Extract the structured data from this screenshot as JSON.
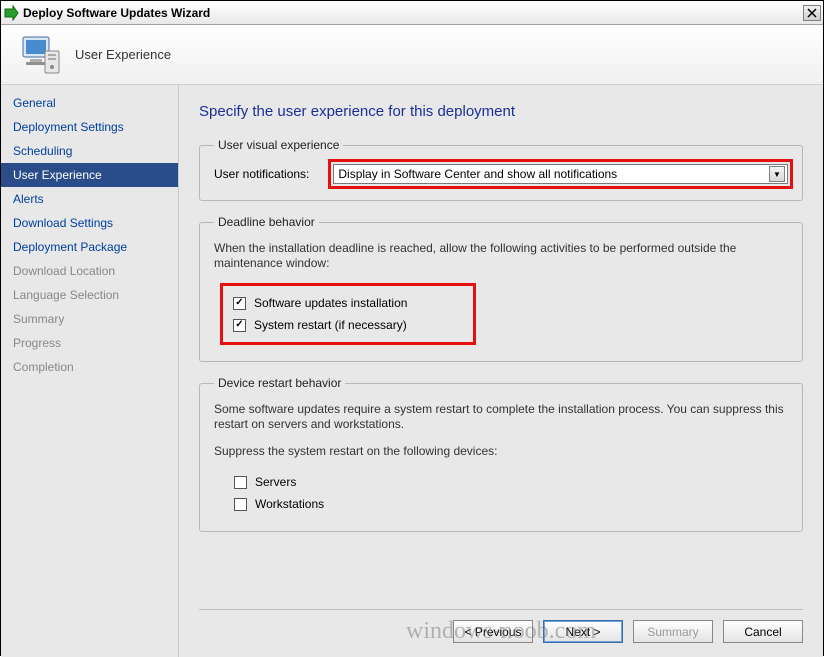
{
  "titlebar": {
    "title": "Deploy Software Updates Wizard"
  },
  "banner": {
    "text": "User Experience"
  },
  "sidebar": {
    "items": [
      {
        "label": "General",
        "state": "enabled"
      },
      {
        "label": "Deployment Settings",
        "state": "enabled"
      },
      {
        "label": "Scheduling",
        "state": "enabled"
      },
      {
        "label": "User Experience",
        "state": "selected"
      },
      {
        "label": "Alerts",
        "state": "enabled"
      },
      {
        "label": "Download Settings",
        "state": "enabled"
      },
      {
        "label": "Deployment Package",
        "state": "enabled"
      },
      {
        "label": "Download Location",
        "state": "disabled"
      },
      {
        "label": "Language Selection",
        "state": "disabled"
      },
      {
        "label": "Summary",
        "state": "disabled"
      },
      {
        "label": "Progress",
        "state": "disabled"
      },
      {
        "label": "Completion",
        "state": "disabled"
      }
    ]
  },
  "content": {
    "heading": "Specify the user experience for this deployment",
    "visual": {
      "legend": "User visual experience",
      "notif_label": "User notifications:",
      "notif_value": "Display in Software Center and show all notifications"
    },
    "deadline": {
      "legend": "Deadline behavior",
      "desc": "When the installation deadline is reached, allow the following activities to be performed outside the maintenance window:",
      "cb1_label": "Software updates installation",
      "cb1_checked": true,
      "cb2_label": "System restart (if necessary)",
      "cb2_checked": true
    },
    "restart": {
      "legend": "Device restart behavior",
      "desc1": "Some software updates require a system restart to complete the installation process.  You can suppress this restart on servers and workstations.",
      "desc2": "Suppress the system restart on the following devices:",
      "cb1_label": "Servers",
      "cb1_checked": false,
      "cb2_label": "Workstations",
      "cb2_checked": false
    }
  },
  "buttons": {
    "previous": "< Previous",
    "next": "Next >",
    "summary": "Summary",
    "cancel": "Cancel"
  },
  "watermark": "windows-noob.com"
}
